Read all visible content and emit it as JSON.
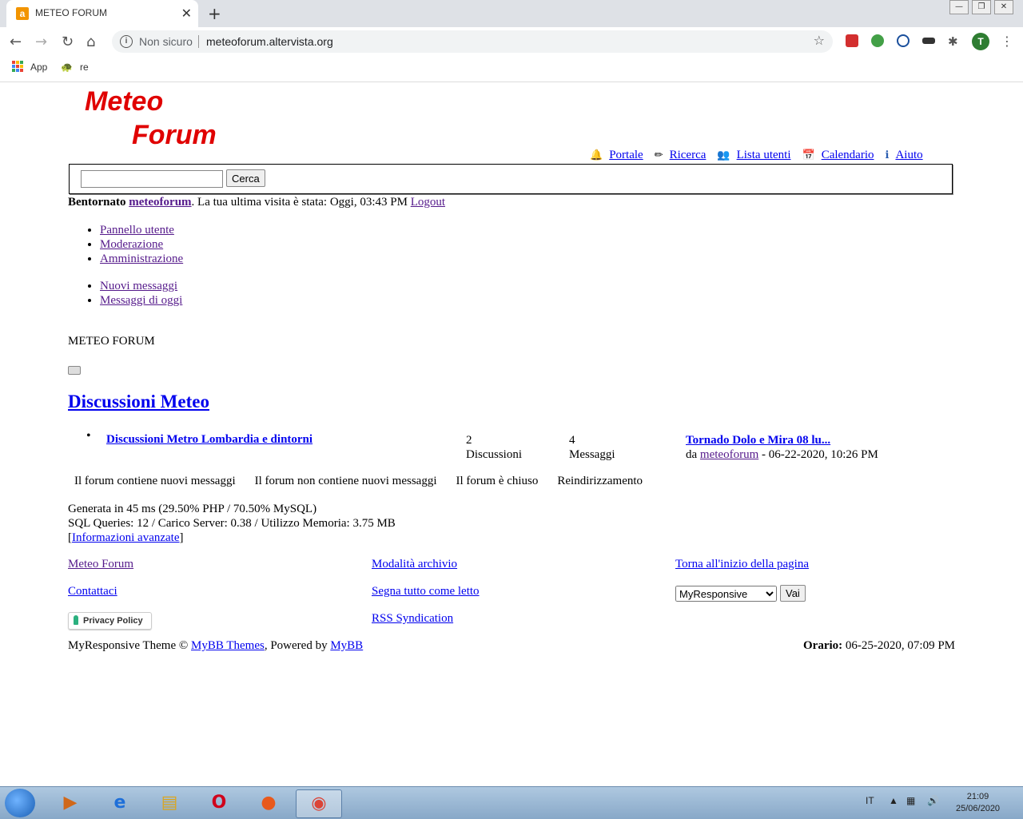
{
  "browser": {
    "tab_title": "METEO FORUM",
    "tab_favicon": "a",
    "security_label": "Non sicuro",
    "url": "meteoforum.altervista.org",
    "bookmarks": [
      "App",
      "re"
    ],
    "profile_initial": "T"
  },
  "header": {
    "logo_line1": "Meteo",
    "logo_line2": "Forum",
    "links": [
      "Portale",
      "Ricerca",
      "Lista utenti",
      "Calendario",
      "Aiuto"
    ],
    "search_button": "Cerca"
  },
  "welcome": {
    "prefix": "Bentornato",
    "user": "meteoforum",
    "text": ". La tua ultima visita è stata: Oggi, 03:43 PM",
    "logout": "Logout"
  },
  "menu1": [
    "Pannello utente",
    "Moderazione",
    "Amministrazione"
  ],
  "menu2": [
    "Nuovi messaggi",
    "Messaggi di oggi"
  ],
  "forum_title": "METEO FORUM",
  "category": "Discussioni Meteo",
  "forum_row": {
    "name": "Discussioni Metro Lombardia e dintorni",
    "threads_count": "2",
    "threads_label": "Discussioni",
    "posts_count": "4",
    "posts_label": "Messaggi",
    "last_title": "Tornado Dolo e Mira 08 lu...",
    "last_by": "da",
    "last_user": "meteoforum",
    "last_date": "- 06-22-2020, 10:26 PM"
  },
  "legend": [
    "Il forum contiene nuovi messaggi",
    "Il forum non contiene nuovi messaggi",
    "Il forum è chiuso",
    "Reindirizzamento"
  ],
  "stats": {
    "line1": "Generata in 45 ms (29.50% PHP / 70.50% MySQL)",
    "line2": "SQL Queries: 12 / Carico Server: 0.38 / Utilizzo Memoria: 3.75 MB",
    "adv_link": "Informazioni avanzate"
  },
  "footer": {
    "links": [
      "Meteo Forum",
      "Modalità archivio",
      "Torna all'inizio della pagina",
      "Contattaci",
      "Segna tutto come letto",
      "RSS Syndication"
    ],
    "theme_select": "MyResponsive",
    "go_button": "Vai",
    "privacy": "Privacy Policy",
    "copyright_prefix": "MyResponsive Theme ©",
    "themes_link": "MyBB Themes",
    "powered": ", Powered by",
    "mybb_link": "MyBB",
    "orario_label": "Orario:",
    "orario_value": "06-25-2020, 07:09 PM"
  },
  "taskbar": {
    "lang": "IT",
    "time": "21:09",
    "date": "25/06/2020"
  }
}
